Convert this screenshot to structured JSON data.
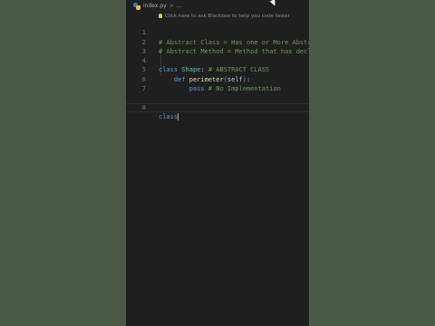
{
  "breadcrumb": {
    "file_name": "index.py",
    "separator": ">",
    "ellipsis": "..."
  },
  "hint": {
    "text": "Click here to ask Blackbox to help you code faster"
  },
  "code": {
    "lines": [
      {
        "number": "1",
        "comment": "# Abstract Class = Has one or More Abstr"
      },
      {
        "number": "2",
        "comment": "# Abstract Method = Method that has decl"
      },
      {
        "number": "3"
      },
      {
        "number": "4",
        "kw": "class",
        "name": "Shape",
        "colon": ":",
        "comment": "# ABSTRACT CLASS"
      },
      {
        "number": "5",
        "kw": "def",
        "name": "perimeter",
        "open": "(",
        "param": "self",
        "close": ")",
        "colon": ":"
      },
      {
        "number": "6",
        "kw": "pass",
        "comment": "# No Implementation"
      },
      {
        "number": "7"
      },
      {
        "number": "8",
        "kw": "class"
      }
    ]
  },
  "colors": {
    "background": "#4a5a46",
    "editor": "#1f1f1f",
    "comment": "#6a9955",
    "keyword": "#569cd6",
    "class_name": "#4ec9b0",
    "function": "#dcdcaa",
    "parameter": "#9cdcfe"
  }
}
